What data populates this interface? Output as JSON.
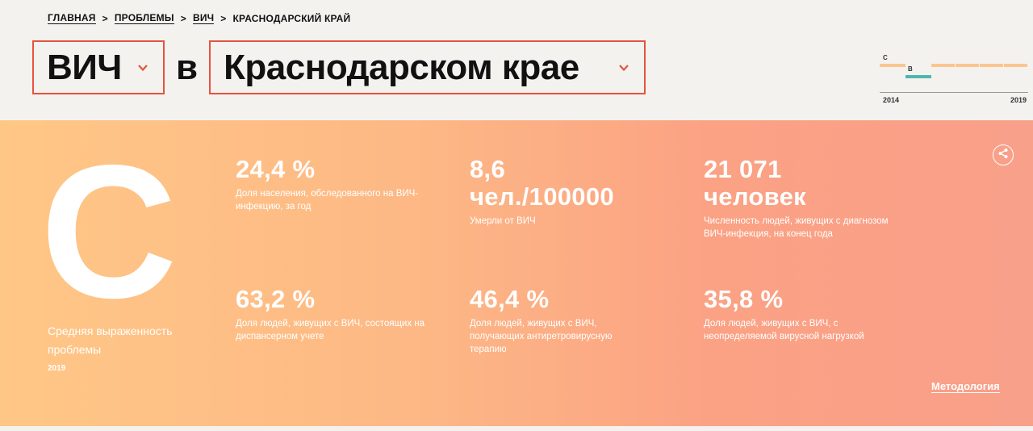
{
  "breadcrumb": {
    "home": "Главная",
    "problems": "Проблемы",
    "problem": "ВИЧ",
    "current": "Краснодарский край",
    "separator": ">"
  },
  "title": {
    "problem_value": "ВИЧ",
    "preposition": "в",
    "region_value": "Краснодарском крае"
  },
  "mini_chart": {
    "years": [
      "2014",
      "2019"
    ],
    "grades": [
      "C",
      "B"
    ],
    "colors": {
      "c_line": "#fcc58f",
      "b_line": "#4fb6ad"
    }
  },
  "grade": {
    "letter": "C",
    "caption": "Средняя выраженность проблемы",
    "year": "2019"
  },
  "stats": [
    {
      "value": "24,4 %",
      "desc": "Доля населения, обследованного на ВИЧ-инфекцию, за год"
    },
    {
      "value": "8,6 чел./100000",
      "desc": "Умерли от ВИЧ"
    },
    {
      "value": "21 071 человек",
      "desc": "Численность людей, живущих с диагнозом ВИЧ-инфекция, на конец года"
    },
    {
      "value": "63,2 %",
      "desc": "Доля людей, живущих с ВИЧ, состоящих на диспансерном учете"
    },
    {
      "value": "46,4 %",
      "desc": "Доля людей, живущих с ВИЧ, получающих антиретровирусную терапию"
    },
    {
      "value": "35,8 %",
      "desc": "Доля людей, живущих с ВИЧ, с неопределяемой вирусной нагрузкой"
    }
  ],
  "actions": {
    "methodology": "Методология",
    "share_icon": "share-icon"
  },
  "colors": {
    "accent": "#e5533d",
    "panel_start": "#ffc786",
    "panel_end": "#f9a08a"
  }
}
